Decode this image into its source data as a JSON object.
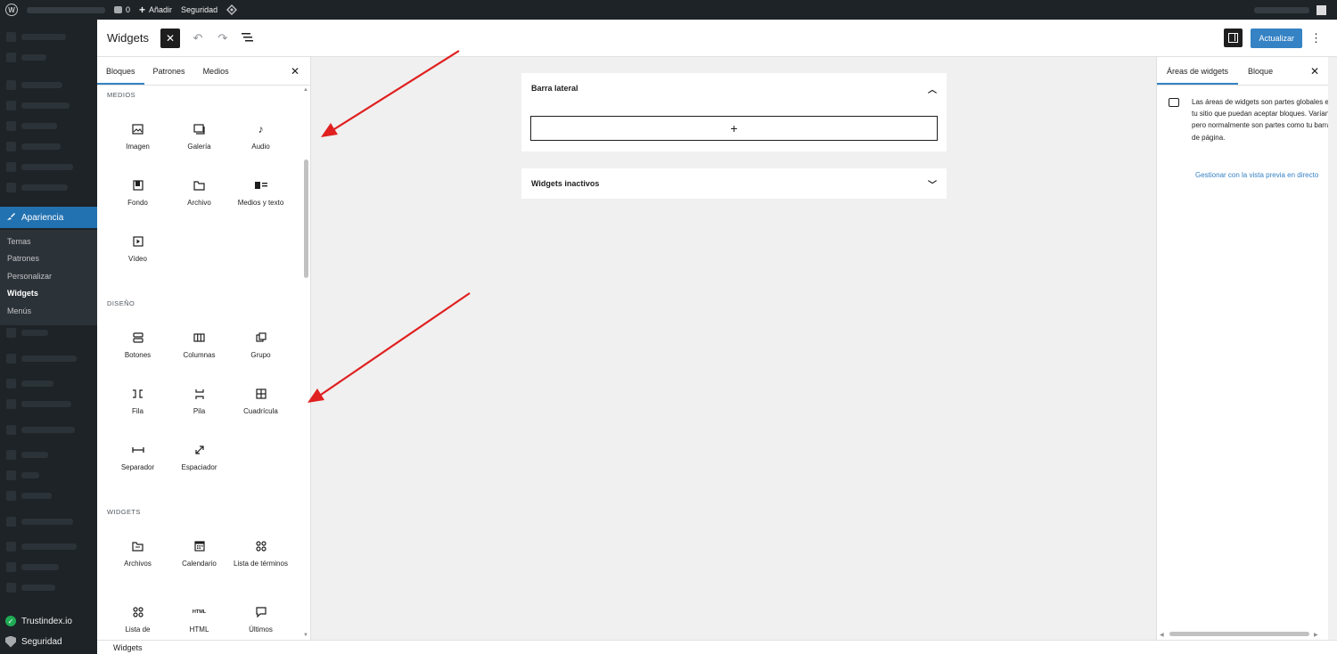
{
  "admin_bar": {
    "comments_count": "0",
    "add_new_label": "Añadir",
    "security_label": "Seguridad"
  },
  "admin_menu": {
    "active_section": "Apariencia",
    "submenu": [
      "Temas",
      "Patrones",
      "Personalizar",
      "Widgets",
      "Menús"
    ],
    "current_submenu": "Widgets",
    "bottom_items": [
      "Trustindex.io",
      "Seguridad"
    ]
  },
  "editor": {
    "title": "Widgets",
    "update_button": "Actualizar"
  },
  "inserter": {
    "tabs": [
      "Bloques",
      "Patrones",
      "Medios"
    ],
    "categories": {
      "medios": {
        "title": "MEDIOS",
        "blocks": [
          {
            "label": "Imagen",
            "icon": "image-icon"
          },
          {
            "label": "Galería",
            "icon": "gallery-icon"
          },
          {
            "label": "Audio",
            "icon": "audio-icon"
          },
          {
            "label": "Fondo",
            "icon": "cover-icon"
          },
          {
            "label": "Archivo",
            "icon": "file-icon"
          },
          {
            "label": "Medios y texto",
            "icon": "media-text-icon"
          },
          {
            "label": "Vídeo",
            "icon": "video-icon"
          }
        ]
      },
      "diseno": {
        "title": "DISEÑO",
        "blocks": [
          {
            "label": "Botones",
            "icon": "buttons-icon"
          },
          {
            "label": "Columnas",
            "icon": "columns-icon"
          },
          {
            "label": "Grupo",
            "icon": "group-icon"
          },
          {
            "label": "Fila",
            "icon": "row-icon"
          },
          {
            "label": "Pila",
            "icon": "stack-icon"
          },
          {
            "label": "Cuadrícula",
            "icon": "grid-icon"
          },
          {
            "label": "Separador",
            "icon": "separator-icon"
          },
          {
            "label": "Espaciador",
            "icon": "spacer-icon"
          }
        ]
      },
      "widgets": {
        "title": "WIDGETS",
        "blocks": [
          {
            "label": "Archivos",
            "icon": "archives-icon"
          },
          {
            "label": "Calendario",
            "icon": "calendar-icon"
          },
          {
            "label": "Lista de términos",
            "icon": "terms-list-icon"
          },
          {
            "label": "Lista de",
            "icon": "categories-list-icon"
          },
          {
            "label": "HTML",
            "icon": "html-icon"
          },
          {
            "label": "Últimos",
            "icon": "comments-icon"
          }
        ]
      }
    }
  },
  "canvas": {
    "areas": [
      {
        "title": "Barra lateral",
        "expanded": true
      },
      {
        "title": "Widgets inactivos",
        "expanded": false
      }
    ]
  },
  "settings": {
    "tabs": [
      "Áreas de widgets",
      "Bloque"
    ],
    "description": "Las áreas de widgets son partes globales en el diseño de tu sitio que puedan aceptar bloques. Varían según el tema, pero normalmente son partes como tu barra lateral o el pie de página.",
    "link": "Gestionar con la vista previa en directo"
  },
  "footer": {
    "breadcrumb": "Widgets"
  },
  "colors": {
    "admin_dark": "#1d2327",
    "accent": "#3582c4",
    "annotation_arrow": "#e02020"
  }
}
